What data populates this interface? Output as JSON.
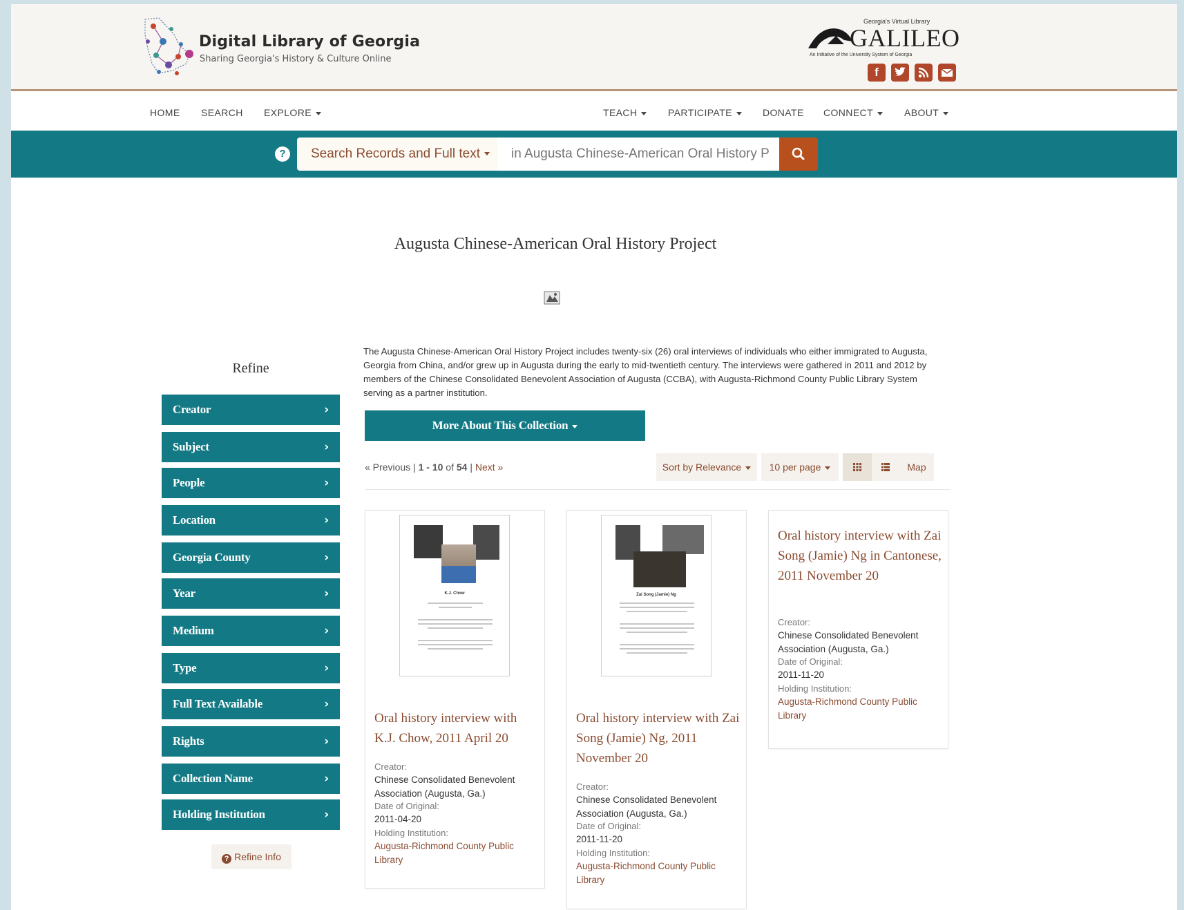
{
  "header": {
    "site_title": "Digital Library of Georgia",
    "site_tagline": "Sharing Georgia's History & Culture Online",
    "galileo_kicker": "Georgia's Virtual Library",
    "galileo_name": "GALILEO",
    "galileo_sub": "An Initiative of the University System of Georgia",
    "social_icons": [
      "facebook-icon",
      "twitter-icon",
      "rss-icon",
      "email-icon"
    ]
  },
  "nav": {
    "left": [
      "HOME",
      "SEARCH",
      "EXPLORE"
    ],
    "right": [
      "TEACH",
      "PARTICIPATE",
      "DONATE",
      "CONNECT",
      "ABOUT"
    ]
  },
  "search": {
    "type_label": "Search Records and Full text",
    "placeholder": "in Augusta Chinese-American Oral History P"
  },
  "page": {
    "title": "Augusta Chinese-American Oral History Project",
    "description": "The Augusta Chinese-American Oral History Project includes twenty-six (26) oral interviews of individuals who either immigrated to Augusta, Georgia from China, and/or grew up in Augusta during the early to mid-twentieth century. The interviews were gathered in 2011 and 2012 by members of the Chinese Consolidated Benevolent Association of Augusta (CCBA), with Augusta-Richmond County Public Library System serving as a partner institution.",
    "more_button": "More About This Collection"
  },
  "sidebar": {
    "heading": "Refine",
    "facets": [
      "Creator",
      "Subject",
      "People",
      "Location",
      "Georgia County",
      "Year",
      "Medium",
      "Type",
      "Full Text Available",
      "Rights",
      "Collection Name",
      "Holding Institution"
    ],
    "refine_info": "Refine Info"
  },
  "results": {
    "prev": "« Previous",
    "range": "1 - 10",
    "of": "of",
    "total": "54",
    "next": "Next »",
    "sort_label": "Sort by Relevance",
    "per_page_label": "10 per page",
    "map_label": "Map",
    "items": [
      {
        "title": "Oral history interview with K.J. Chow, 2011 April 20",
        "creator_label": "Creator:",
        "creator": "Chinese Consolidated Benevolent Association (Augusta, Ga.)",
        "date_label": "Date of Original:",
        "date": "2011-04-20",
        "holding_label": "Holding Institution:",
        "holding": "Augusta-Richmond County Public Library",
        "thumb_caption": "K.J. Chow"
      },
      {
        "title": "Oral history interview with Zai Song (Jamie) Ng, 2011 November 20",
        "creator_label": "Creator:",
        "creator": "Chinese Consolidated Benevolent Association (Augusta, Ga.)",
        "date_label": "Date of Original:",
        "date": "2011-11-20",
        "holding_label": "Holding Institution:",
        "holding": "Augusta-Richmond County Public Library",
        "thumb_caption": "Zai Song (Jamie) Ng"
      },
      {
        "title": "Oral history interview with Zai Song (Jamie) Ng in Cantonese, 2011 November 20",
        "creator_label": "Creator:",
        "creator": "Chinese Consolidated Benevolent Association (Augusta, Ga.)",
        "date_label": "Date of Original:",
        "date": "2011-11-20",
        "holding_label": "Holding Institution:",
        "holding": "Augusta-Richmond County Public Library"
      }
    ]
  },
  "colors": {
    "teal": "#137a85",
    "rust": "#8a4b30",
    "search_button": "#b8501e",
    "social": "#b0462a"
  }
}
